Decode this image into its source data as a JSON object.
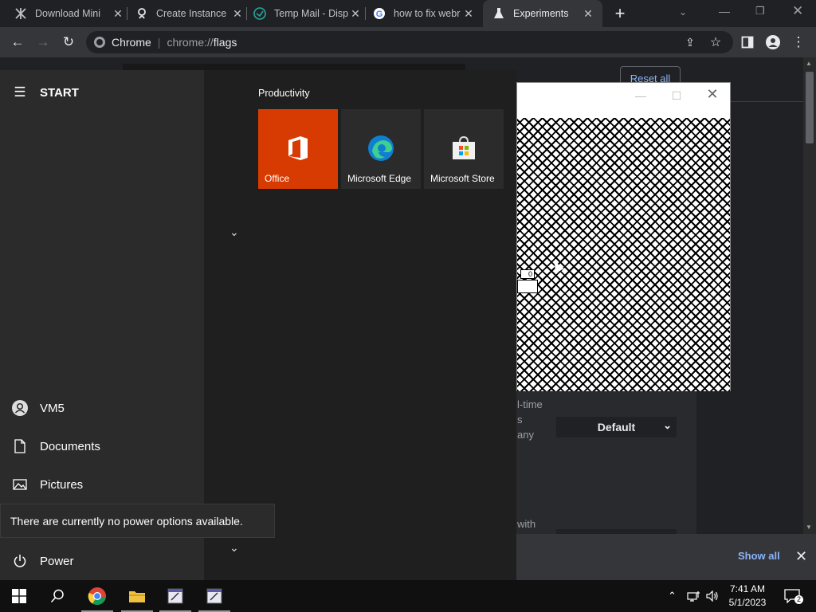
{
  "browser": {
    "tabs": [
      {
        "title": "Download Mini",
        "icon": "app-icon"
      },
      {
        "title": "Create Instance",
        "icon": "person-icon"
      },
      {
        "title": "Temp Mail - Disp",
        "icon": "tempmail-icon"
      },
      {
        "title": "how to fix webr",
        "icon": "google-icon"
      },
      {
        "title": "Experiments",
        "icon": "flask-icon"
      }
    ],
    "new_tab": "+",
    "omnibox": {
      "site_label": "Chrome",
      "separator": "|",
      "url_prefix": "chrome://",
      "url_path": "flags"
    }
  },
  "flags_page": {
    "reset_all": "Reset all",
    "fragment_1": "l-time",
    "fragment_2": "s",
    "fragment_3": "any",
    "fragment_4": "with",
    "select_value": "Default"
  },
  "download_bar": {
    "show_all": "Show all",
    "close": "✕"
  },
  "dialog": {
    "tiny_box_text": "0"
  },
  "start_menu": {
    "header": "START",
    "group_label": "Productivity",
    "tiles": [
      {
        "label": "Office",
        "color": "#d83b01"
      },
      {
        "label": "Microsoft Edge",
        "color": "#2b2b2b"
      },
      {
        "label": "Microsoft Store",
        "color": "#2b2b2b"
      }
    ],
    "items": [
      {
        "label": "VM5",
        "icon": "user-icon"
      },
      {
        "label": "Documents",
        "icon": "document-icon"
      },
      {
        "label": "Pictures",
        "icon": "pictures-icon"
      },
      {
        "label": "Power",
        "icon": "power-icon"
      }
    ],
    "tooltip": "There are currently no power options available."
  },
  "taskbar": {
    "time": "7:41 AM",
    "date": "5/1/2023",
    "notification_count": "2"
  },
  "colors": {
    "office_tile": "#d83b01",
    "link_blue": "#8ab4f8",
    "taskbar": "#101010"
  }
}
